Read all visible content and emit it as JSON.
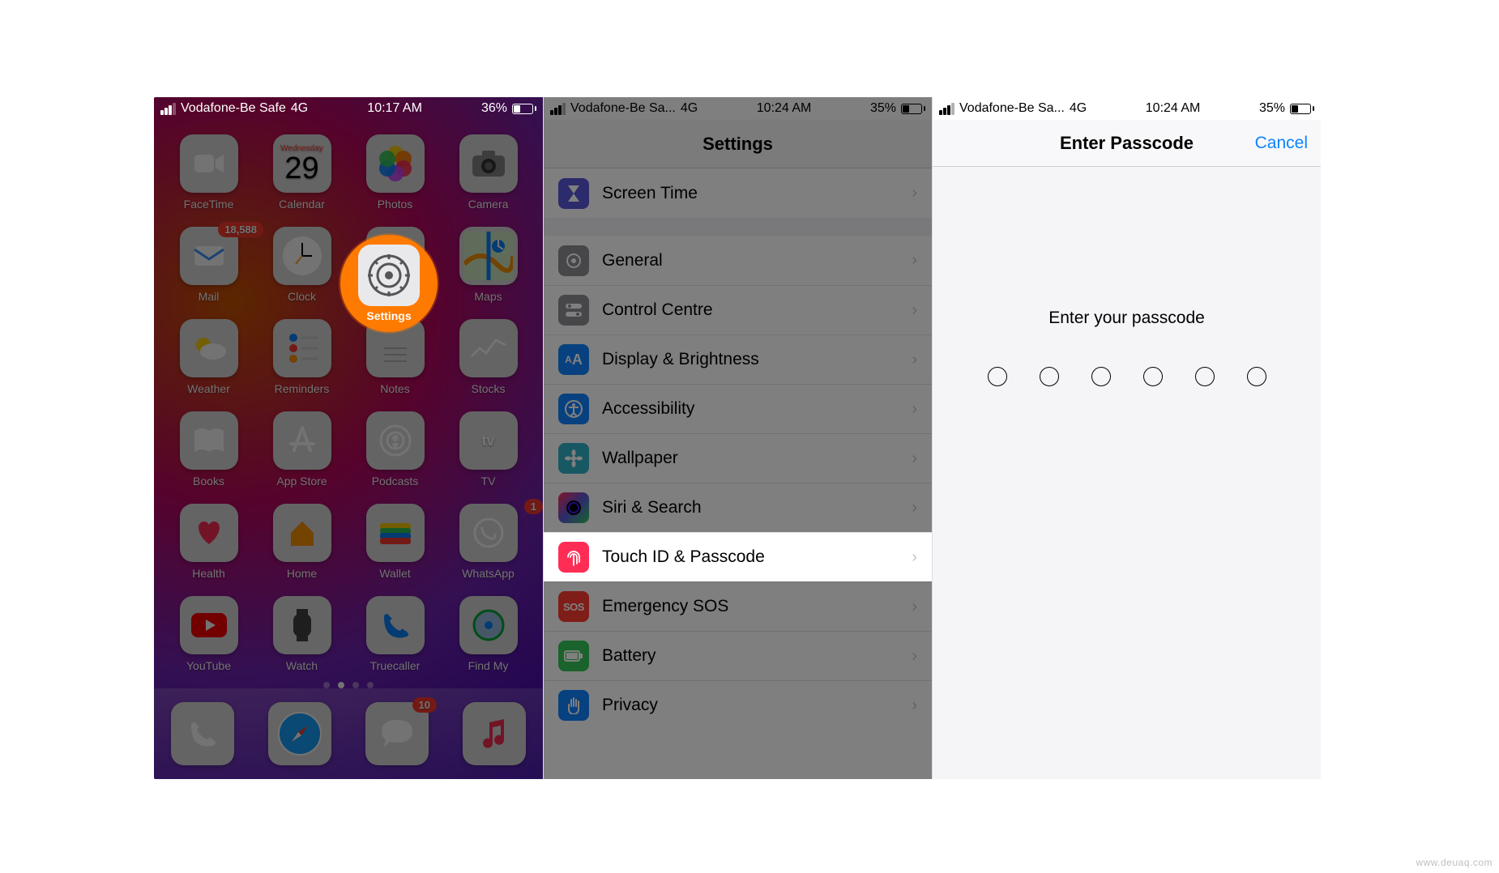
{
  "watermark": "www.deuaq.com",
  "screen1": {
    "status": {
      "carrier": "Vodafone-Be Safe",
      "network": "4G",
      "time": "10:17 AM",
      "battery_pct": "36%"
    },
    "calendar": {
      "weekday": "Wednesday",
      "day": "29"
    },
    "highlight_label": "Settings",
    "apps": {
      "r1": [
        {
          "label": "FaceTime",
          "badge": null
        },
        {
          "label": "Calendar",
          "badge": null
        },
        {
          "label": "Photos",
          "badge": null
        },
        {
          "label": "Camera",
          "badge": null
        }
      ],
      "r2": [
        {
          "label": "Mail",
          "badge": "18,588"
        },
        {
          "label": "Clock",
          "badge": null
        },
        {
          "label": "Settings",
          "badge": null
        },
        {
          "label": "Maps",
          "badge": null
        }
      ],
      "r3": [
        {
          "label": "Weather",
          "badge": null
        },
        {
          "label": "Reminders",
          "badge": null
        },
        {
          "label": "Notes",
          "badge": null
        },
        {
          "label": "Stocks",
          "badge": null
        }
      ],
      "r4": [
        {
          "label": "Books",
          "badge": null
        },
        {
          "label": "App Store",
          "badge": null
        },
        {
          "label": "Podcasts",
          "badge": null
        },
        {
          "label": "TV",
          "badge": null
        }
      ],
      "r5": [
        {
          "label": "Health",
          "badge": null
        },
        {
          "label": "Home",
          "badge": null
        },
        {
          "label": "Wallet",
          "badge": null
        },
        {
          "label": "WhatsApp",
          "badge": "1"
        }
      ],
      "r6": [
        {
          "label": "YouTube",
          "badge": null
        },
        {
          "label": "Watch",
          "badge": null
        },
        {
          "label": "Truecaller",
          "badge": null
        },
        {
          "label": "Find My",
          "badge": null
        }
      ],
      "dock": [
        {
          "label": "Phone",
          "badge": null
        },
        {
          "label": "Safari",
          "badge": null
        },
        {
          "label": "Messages",
          "badge": "10"
        },
        {
          "label": "Music",
          "badge": null
        }
      ]
    }
  },
  "screen2": {
    "status": {
      "carrier": "Vodafone-Be Sa...",
      "network": "4G",
      "time": "10:24 AM",
      "battery_pct": "35%"
    },
    "title": "Settings",
    "items": [
      {
        "label": "Screen Time"
      },
      {
        "label": "General"
      },
      {
        "label": "Control Centre"
      },
      {
        "label": "Display & Brightness"
      },
      {
        "label": "Accessibility"
      },
      {
        "label": "Wallpaper"
      },
      {
        "label": "Siri & Search"
      },
      {
        "label": "Touch ID & Passcode"
      },
      {
        "label": "Emergency SOS"
      },
      {
        "label": "Battery"
      },
      {
        "label": "Privacy"
      }
    ]
  },
  "screen3": {
    "status": {
      "carrier": "Vodafone-Be Sa...",
      "network": "4G",
      "time": "10:24 AM",
      "battery_pct": "35%"
    },
    "title": "Enter Passcode",
    "cancel": "Cancel",
    "prompt": "Enter your passcode"
  }
}
